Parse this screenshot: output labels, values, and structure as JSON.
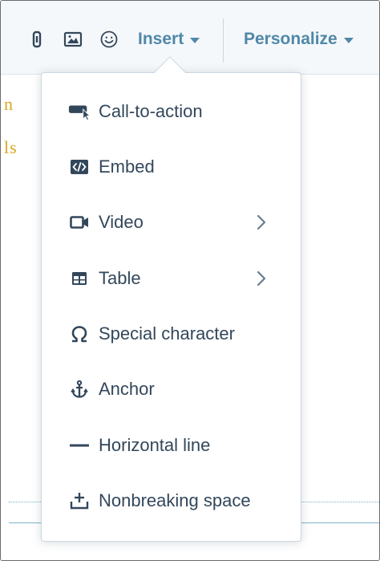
{
  "toolbar": {
    "icons": [
      "link-icon",
      "image-icon",
      "emoji-icon"
    ],
    "insert_label": "Insert",
    "personalize_label": "Personalize"
  },
  "background": {
    "fragment_1": "n",
    "fragment_2": "ls"
  },
  "insert_menu": {
    "items": [
      {
        "label": "Call-to-action",
        "icon": "cta-icon",
        "has_submenu": false
      },
      {
        "label": "Embed",
        "icon": "embed-icon",
        "has_submenu": false
      },
      {
        "label": "Video",
        "icon": "video-icon",
        "has_submenu": true
      },
      {
        "label": "Table",
        "icon": "table-icon",
        "has_submenu": true
      },
      {
        "label": "Special character",
        "icon": "omega-icon",
        "has_submenu": false
      },
      {
        "label": "Anchor",
        "icon": "anchor-icon",
        "has_submenu": false
      },
      {
        "label": "Horizontal line",
        "icon": "horizontal-line-icon",
        "has_submenu": false
      },
      {
        "label": "Nonbreaking space",
        "icon": "nonbreaking-space-icon",
        "has_submenu": false
      }
    ]
  },
  "colors": {
    "accent": "#4f88a8",
    "text": "#33475b",
    "border": "#cbd6e2"
  }
}
